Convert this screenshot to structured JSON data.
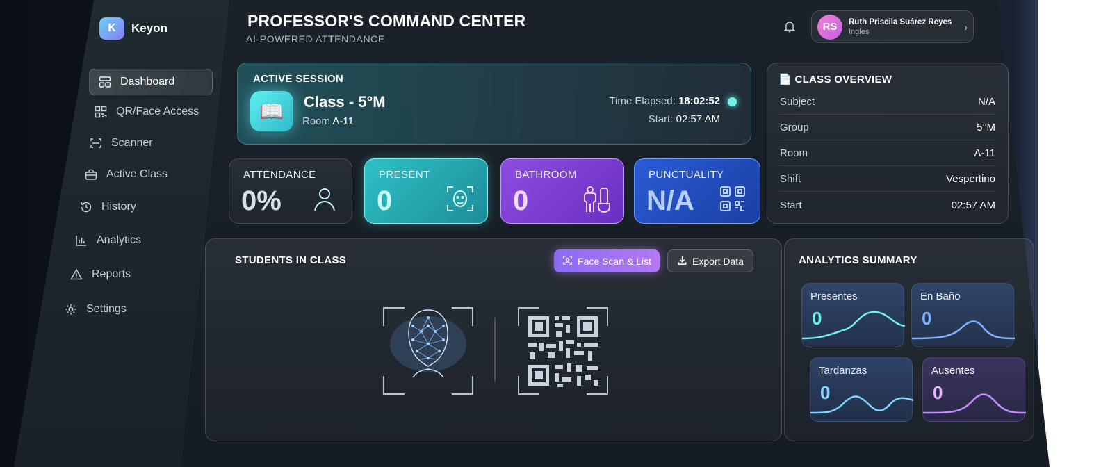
{
  "brand": {
    "initial": "K",
    "name": "Keyon"
  },
  "sidebar": {
    "items": [
      {
        "label": "Dashboard",
        "icon": "dashboard-icon",
        "active": true
      },
      {
        "label": "QR/Face Access",
        "icon": "qr-icon"
      },
      {
        "label": "Scanner",
        "icon": "scanner-icon"
      },
      {
        "label": "Active Class",
        "icon": "briefcase-icon"
      },
      {
        "label": "History",
        "icon": "history-icon"
      },
      {
        "label": "Analytics",
        "icon": "bar-chart-icon"
      },
      {
        "label": "Reports",
        "icon": "warning-icon"
      },
      {
        "label": "Settings",
        "icon": "gear-icon"
      }
    ]
  },
  "header": {
    "title": "PROFESSOR'S COMMAND CENTER",
    "subtitle": "AI-POWERED ATTENDANCE"
  },
  "user": {
    "initials": "RS",
    "name": "Ruth Priscila Suárez Reyes",
    "role": "Ingles"
  },
  "session": {
    "title": "ACTIVE SESSION",
    "class_name": "Class - 5°M",
    "room_label": "Room",
    "room": "A-11",
    "elapsed_label": "Time Elapsed:",
    "elapsed": "18:02:52",
    "start_label": "Start:",
    "start": "02:57 AM"
  },
  "stats": {
    "attendance": {
      "label": "ATTENDANCE",
      "value": "0%"
    },
    "present": {
      "label": "PRESENT",
      "value": "0"
    },
    "bathroom": {
      "label": "BATHROOM",
      "value": "0"
    },
    "punctuality": {
      "label": "PUNCTUALITY",
      "value": "N/A"
    }
  },
  "overview": {
    "title": "CLASS OVERVIEW",
    "rows": [
      {
        "k": "Subject",
        "v": "N/A"
      },
      {
        "k": "Group",
        "v": "5°M"
      },
      {
        "k": "Room",
        "v": "A-11"
      },
      {
        "k": "Shift",
        "v": "Vespertino"
      },
      {
        "k": "Start",
        "v": "02:57 AM"
      }
    ]
  },
  "students": {
    "title": "STUDENTS IN CLASS",
    "face_scan_label": "Face Scan & List",
    "export_label": "Export Data"
  },
  "summary": {
    "title": "ANALYTICS SUMMARY",
    "tiles": [
      {
        "label": "Presentes",
        "value": "0",
        "color": "#6ff1e8"
      },
      {
        "label": "En Baño",
        "value": "0",
        "color": "#7fb3ff"
      },
      {
        "label": "Tardanzas",
        "value": "0",
        "color": "#7fd6ff"
      },
      {
        "label": "Ausentes",
        "value": "0",
        "color": "#c48cff"
      }
    ]
  },
  "colors": {
    "accent_teal": "#6ff1e8",
    "accent_purple": "#b678f2",
    "accent_blue": "#2a5bd6"
  }
}
